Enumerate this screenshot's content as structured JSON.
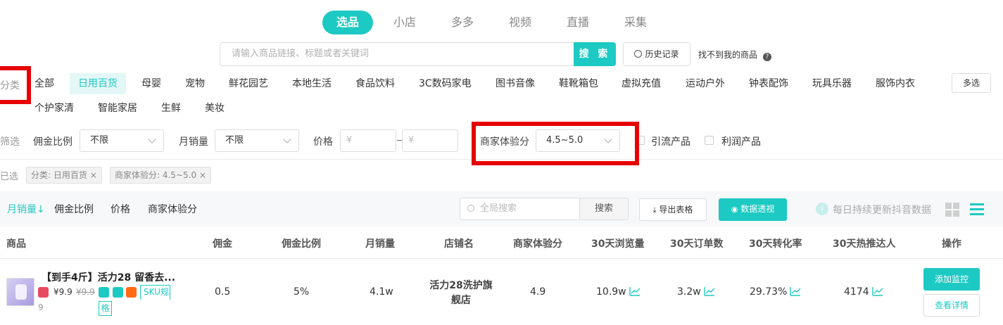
{
  "tabs": [
    "选品",
    "小店",
    "多多",
    "视频",
    "直播",
    "采集"
  ],
  "search": {
    "placeholder": "请输入商品链接、标题或者关键词",
    "button": "搜 索",
    "history": "历史记录",
    "not_found": "找不到我的商品"
  },
  "categories": {
    "label": "分类",
    "items": [
      "全部",
      "日用百货",
      "母婴",
      "宠物",
      "鲜花园艺",
      "本地生活",
      "食品饮料",
      "3C数码家电",
      "图书音像",
      "鞋靴箱包",
      "虚拟充值",
      "运动户外",
      "钟表配饰",
      "玩具乐器",
      "服饰内衣",
      "个护家清",
      "智能家居",
      "生鲜",
      "美妆"
    ],
    "more": "多选"
  },
  "filters": {
    "label": "筛选",
    "commission_label": "佣金比例",
    "commission_value": "不限",
    "sales_label": "月销量",
    "sales_value": "不限",
    "price_label": "价格",
    "price_placeholder": "¥",
    "merchant_label": "商家体验分",
    "merchant_value": "4.5~5.0",
    "traffic": "引流产品",
    "profit": "利润产品"
  },
  "selected": {
    "label": "已选",
    "chips": [
      "分类: 日用百货",
      "商家体验分: 4.5~5.0"
    ]
  },
  "toolbar": {
    "sorts": [
      "月销量↓",
      "佣金比例",
      "价格",
      "商家体验分"
    ],
    "search_placeholder": "全局搜索",
    "search_btn": "搜索",
    "export": "导出表格",
    "pivot": "数据透视",
    "notice": "每日持续更新抖音数据"
  },
  "table": {
    "headers": [
      "商品",
      "佣金",
      "佣金比例",
      "月销量",
      "店铺名",
      "商家体验分",
      "30天浏览量",
      "30天订单数",
      "30天转化率",
      "30天热推达人",
      "操作"
    ],
    "rows": [
      {
        "title": "【到手4斤】活力28 留香去...",
        "price": "¥9.9",
        "orig_price": "¥9.9",
        "sku": "SKU规格",
        "commission": "0.5",
        "rate": "5%",
        "sales": "4.1w",
        "shop": "活力28洗护旗舰店",
        "score": "4.9",
        "views": "10.9w",
        "orders": "3.2w",
        "conv": "29.73%",
        "kols": "4174",
        "btn_monitor": "添加监控",
        "btn_detail": "查看详情"
      }
    ]
  }
}
